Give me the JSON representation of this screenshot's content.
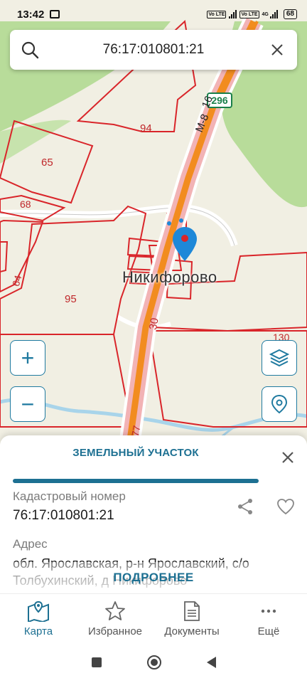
{
  "status": {
    "time": "13:42",
    "volte1": "Vo LTE",
    "volte2": "Vo LTE",
    "net": "4G",
    "battery": "68"
  },
  "search": {
    "value": "76:17:010801:21",
    "icon": "search-icon",
    "clear_icon": "close-icon"
  },
  "map": {
    "place_name": "Никифорово",
    "road_name": "М-8",
    "road_number": "16",
    "road_shield": "296",
    "parcel_labels": {
      "p94": "94",
      "p65": "65",
      "p68": "68",
      "p64": "64",
      "p95": "95",
      "p30": "30",
      "p130": "130",
      "p77": "77"
    },
    "colors": {
      "forest": "#b8dc9a",
      "land": "#f1efe3",
      "parcel": "#d9252a",
      "road": "#f28c1f",
      "water": "#a8d4ea",
      "marker": "#1e88d8"
    },
    "buttons": {
      "zoom_in": "+",
      "zoom_out": "−",
      "layers_icon": "layers-icon",
      "locate_icon": "location-pin-icon"
    }
  },
  "sheet": {
    "title": "ЗЕМЕЛЬНЫЙ УЧАСТОК",
    "cadastral_label": "Кадастровый номер",
    "cadastral_value": "76:17:010801:21",
    "address_label": "Адрес",
    "address_value": "обл. Ярославская, р-н Ярославский, с/о Толбухинский, д Никифорово",
    "more": "ПОДРОБНЕЕ",
    "accent": "#1d7092"
  },
  "nav": {
    "map": "Карта",
    "favorites": "Избранное",
    "documents": "Документы",
    "more": "Ещё"
  }
}
